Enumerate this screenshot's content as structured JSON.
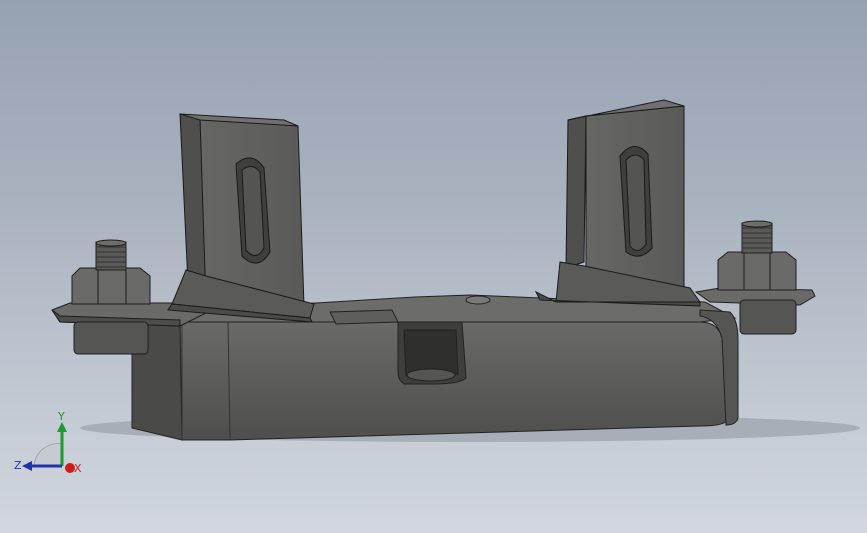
{
  "viewport": {
    "background_top": "#97a2b1",
    "background_bottom": "#d2d7de",
    "model_color": "#5f5f5d"
  },
  "triad": {
    "x_label": "X",
    "y_label": "Y",
    "z_label": "Z",
    "x_color": "#d11a1a",
    "y_color": "#1c9a2c",
    "z_color": "#2334a8"
  }
}
